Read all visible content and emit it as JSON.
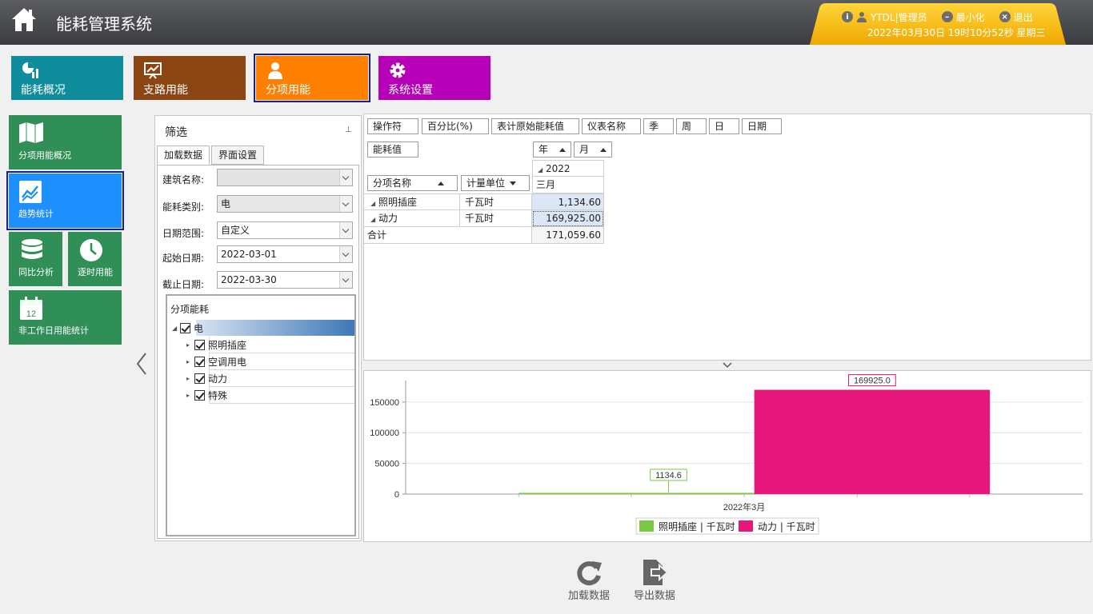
{
  "header": {
    "title": "能耗管理系统",
    "user": "YTDL|管理员",
    "minimize": "最小化",
    "logout": "退出",
    "datetime": "2022年03月30日 19时10分52秒 星期三"
  },
  "modules": [
    {
      "label": "能耗概况",
      "color": "#0e8c9b"
    },
    {
      "label": "支路用能",
      "color": "#8a4512"
    },
    {
      "label": "分项用能",
      "color": "#ff7f00"
    },
    {
      "label": "系统设置",
      "color": "#b600b7"
    }
  ],
  "side_tiles": [
    {
      "label": "分项用能概况"
    },
    {
      "label": "趋势统计"
    },
    {
      "label": "同比分析"
    },
    {
      "label": "逐时用能"
    },
    {
      "label": "非工作日用能统计",
      "icon_text": "12"
    }
  ],
  "filter": {
    "title": "筛选",
    "tabs": [
      "加载数据",
      "界面设置"
    ],
    "building_label": "建筑名称:",
    "building_value": "",
    "type_label": "能耗类别:",
    "type_value": "电",
    "range_label": "日期范围:",
    "range_value": "自定义",
    "start_label": "起始日期:",
    "start_value": "2022-03-01",
    "end_label": "截止日期:",
    "end_value": "2022-03-30",
    "tree_header": "分项能耗",
    "tree_root": "电",
    "tree_children": [
      "照明插座",
      "空调用电",
      "动力",
      "特殊"
    ]
  },
  "pivot": {
    "filter_fields": [
      "操作符",
      "百分比(%)",
      "表计原始能耗值",
      "仪表名称",
      "季",
      "周",
      "日",
      "日期"
    ],
    "data_field": "能耗值",
    "col_fields": [
      "年",
      "月"
    ],
    "row_fields": [
      "分项名称",
      "计量单位"
    ],
    "year": "2022",
    "month": "三月",
    "rows": [
      {
        "name": "照明插座",
        "unit": "千瓦时",
        "value": "1,134.60"
      },
      {
        "name": "动力",
        "unit": "千瓦时",
        "value": "169,925.00"
      }
    ],
    "total_label": "合计",
    "total_value": "171,059.60"
  },
  "chart_data": {
    "type": "bar",
    "categories": [
      "2022年3月"
    ],
    "series": [
      {
        "name": "照明插座 | 千瓦时",
        "values": [
          1134.6
        ],
        "color": "#7ac943"
      },
      {
        "name": "动力 | 千瓦时",
        "values": [
          169925.0
        ],
        "color": "#e8177b"
      }
    ],
    "ylim": [
      0,
      185000
    ],
    "yticks": [
      0,
      50000,
      100000,
      150000
    ],
    "data_labels": [
      "1134.6",
      "169925.0"
    ],
    "legend": "bottom-center",
    "grid": true
  },
  "actions": {
    "load": "加载数据",
    "export": "导出数据"
  }
}
